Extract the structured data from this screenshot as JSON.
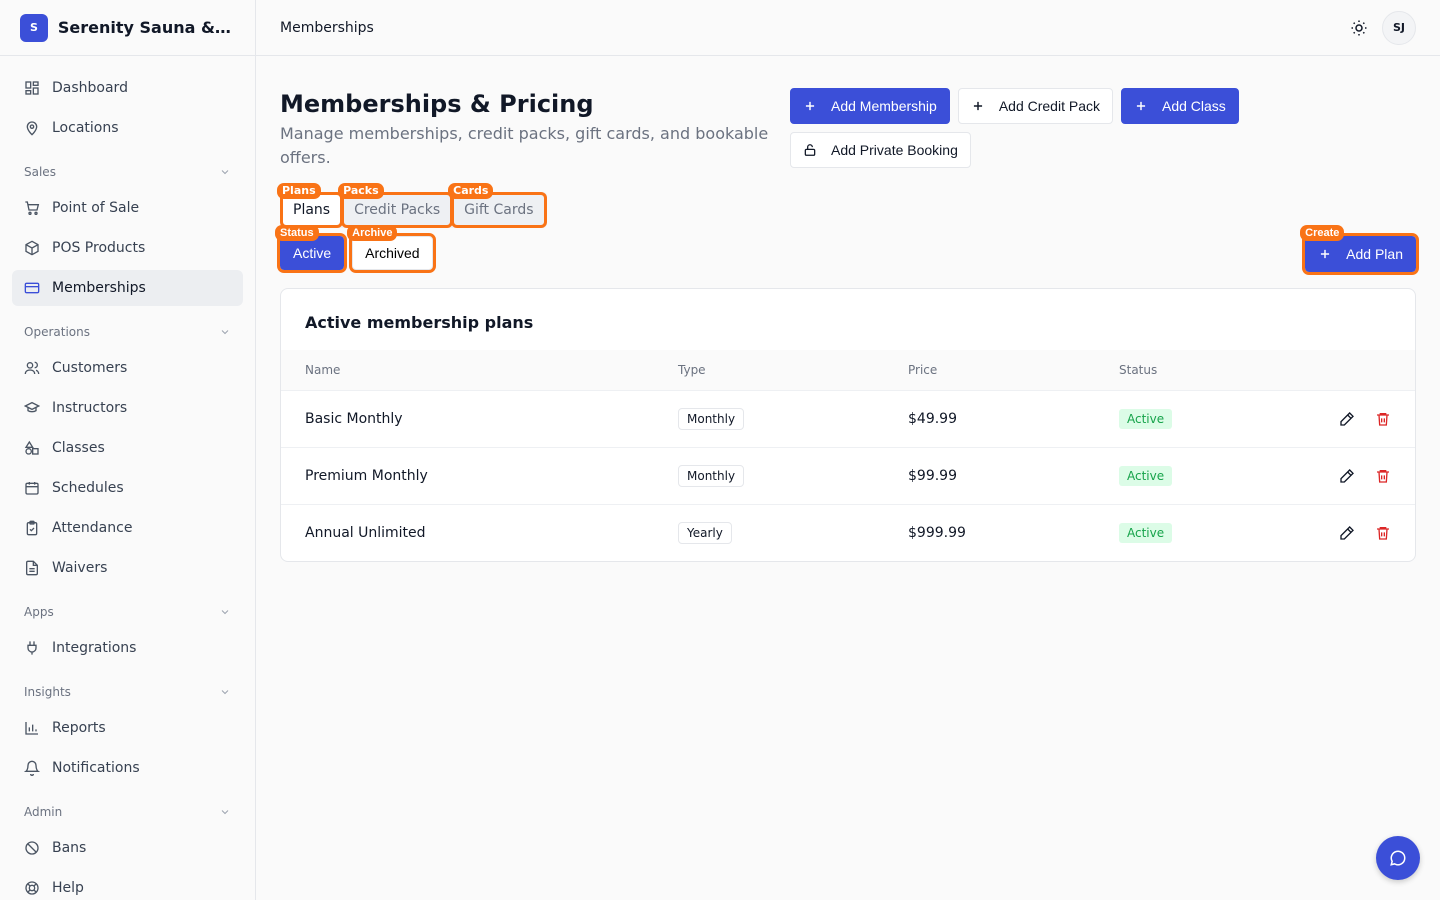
{
  "brand": {
    "initial": "S",
    "name": "Serenity Sauna & Spa"
  },
  "topbar": {
    "title": "Memberships",
    "avatar_initials": "SJ"
  },
  "sidebar": {
    "top_items": [
      {
        "label": "Dashboard",
        "icon": "grid-icon"
      },
      {
        "label": "Locations",
        "icon": "map-pin-icon"
      }
    ],
    "sections": [
      {
        "label": "Sales",
        "items": [
          {
            "label": "Point of Sale",
            "icon": "cart-icon"
          },
          {
            "label": "POS Products",
            "icon": "package-icon"
          },
          {
            "label": "Memberships",
            "icon": "credit-card-icon",
            "active": true
          }
        ]
      },
      {
        "label": "Operations",
        "items": [
          {
            "label": "Customers",
            "icon": "users-icon"
          },
          {
            "label": "Instructors",
            "icon": "graduation-cap-icon"
          },
          {
            "label": "Classes",
            "icon": "shapes-icon"
          },
          {
            "label": "Schedules",
            "icon": "calendar-icon"
          },
          {
            "label": "Attendance",
            "icon": "clipboard-check-icon"
          },
          {
            "label": "Waivers",
            "icon": "file-text-icon"
          }
        ]
      },
      {
        "label": "Apps",
        "items": [
          {
            "label": "Integrations",
            "icon": "plug-icon"
          }
        ]
      },
      {
        "label": "Insights",
        "items": [
          {
            "label": "Reports",
            "icon": "bar-chart-icon"
          },
          {
            "label": "Notifications",
            "icon": "bell-icon"
          }
        ]
      },
      {
        "label": "Admin",
        "items": [
          {
            "label": "Bans",
            "icon": "ban-icon"
          },
          {
            "label": "Help",
            "icon": "life-buoy-icon"
          }
        ]
      }
    ]
  },
  "page": {
    "title": "Memberships & Pricing",
    "description": "Manage memberships, credit packs, gift cards, and bookable offers.",
    "actions": {
      "add_membership": "Add Membership",
      "add_credit_pack": "Add Credit Pack",
      "add_class": "Add Class",
      "add_private_booking": "Add Private Booking"
    },
    "tabs": {
      "plans": {
        "label": "Plans",
        "tag": "Plans"
      },
      "credit_packs": {
        "label": "Credit Packs",
        "tag": "Packs"
      },
      "gift_cards": {
        "label": "Gift Cards",
        "tag": "Cards"
      }
    },
    "filters": {
      "active": {
        "label": "Active",
        "tag": "Status"
      },
      "archived": {
        "label": "Archived",
        "tag": "Archive"
      }
    },
    "add_plan": {
      "label": "Add Plan",
      "tag": "Create"
    },
    "table": {
      "title": "Active membership plans",
      "headers": {
        "name": "Name",
        "type": "Type",
        "price": "Price",
        "status": "Status"
      },
      "rows": [
        {
          "name": "Basic Monthly",
          "type": "Monthly",
          "price": "$49.99",
          "status": "Active"
        },
        {
          "name": "Premium Monthly",
          "type": "Monthly",
          "price": "$99.99",
          "status": "Active"
        },
        {
          "name": "Annual Unlimited",
          "type": "Yearly",
          "price": "$999.99",
          "status": "Active"
        }
      ]
    }
  },
  "colors": {
    "primary": "#3b4fd8",
    "highlight": "#f97316",
    "active_badge": "#16a34a",
    "danger": "#dc2626"
  }
}
